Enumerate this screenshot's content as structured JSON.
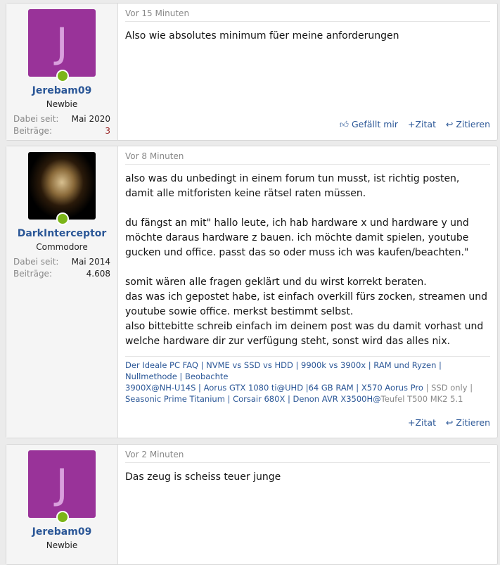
{
  "posts": [
    {
      "user": {
        "initial": "J",
        "name": "Jerebam09",
        "title": "Newbie",
        "joined_label": "Dabei seit:",
        "joined": "Mai 2020",
        "posts_label": "Beiträge:",
        "posts": "3"
      },
      "time": "Vor 15 Minuten",
      "body": "Also wie absolutes minimum füer meine anforderungen",
      "actions": {
        "like": "Gefällt mir",
        "quote": "Zitat",
        "reply": "Zitieren"
      }
    },
    {
      "user": {
        "name": "DarkInterceptor",
        "title": "Commodore",
        "joined_label": "Dabei seit:",
        "joined": "Mai 2014",
        "posts_label": "Beiträge:",
        "posts": "4.608"
      },
      "time": "Vor 8 Minuten",
      "body": "also was du unbedingt in einem forum tun musst, ist richtig posten, damit alle mitforisten keine rätsel raten müssen.\n\ndu fängst an mit\" hallo leute, ich hab hardware x und hardware y und möchte daraus hardware z bauen. ich möchte damit spielen, youtube gucken und office. passt das so oder muss ich was kaufen/beachten.\"\n\nsomit wären alle fragen geklärt und du wirst korrekt beraten.\ndas was ich gepostet habe, ist einfach overkill fürs zocken, streamen und youtube sowie office. merkst bestimmt selbst.\nalso bittebitte schreib einfach im deinem post was du damit vorhast und welche hardware dir zur verfügung steht, sonst wird das alles nix.",
      "signature": {
        "line1": "Der Ideale PC FAQ | NVME vs SSD vs HDD | 9900k vs 3900x | RAM und Ryzen | Nullmethode | Beobachte",
        "line2a": "3900X@NH-U14S | Aorus GTX 1080 ti@UHD |64 GB RAM | X570 Aorus Pro ",
        "line2b": "| SSD only | ",
        "line2c": "Seasonic Prime Titanium | Corsair 680X | Denon AVR X3500H@",
        "line2d": "Teufel T500 MK2 5.1"
      },
      "actions": {
        "quote": "Zitat",
        "reply": "Zitieren"
      }
    },
    {
      "user": {
        "initial": "J",
        "name": "Jerebam09",
        "title": "Newbie"
      },
      "time": "Vor 2 Minuten",
      "body": "Das zeug is scheiss teuer junge"
    }
  ]
}
